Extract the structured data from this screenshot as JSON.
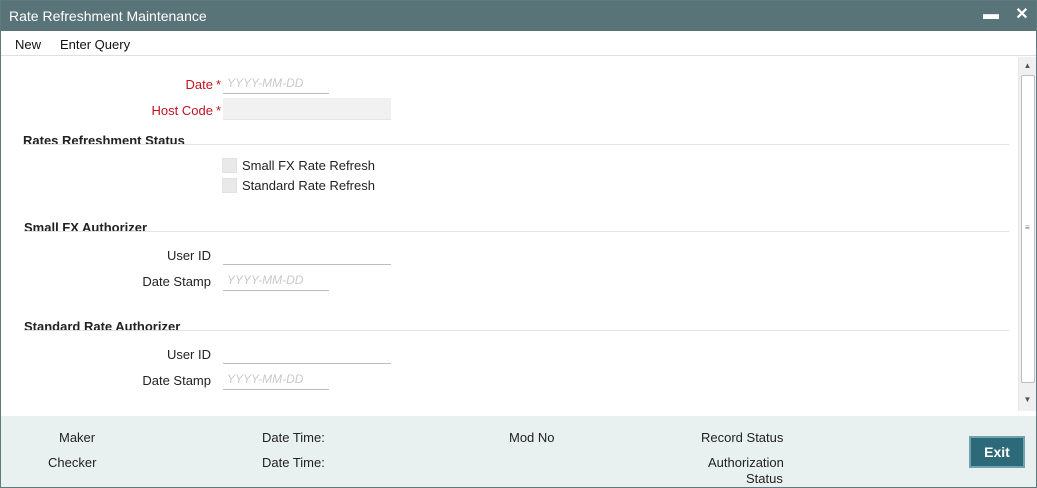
{
  "window": {
    "title": "Rate Refreshment Maintenance",
    "minimize_glyph": "▬",
    "close_glyph": "✕"
  },
  "menu": {
    "new_label": "New",
    "enter_query_label": "Enter Query"
  },
  "form": {
    "date_label": "Date",
    "date_placeholder": "YYYY-MM-DD",
    "host_code_label": "Host Code",
    "required_marker": "*"
  },
  "rates_status": {
    "title": "Rates Refreshment Status",
    "small_fx_label": "Small FX Rate Refresh",
    "standard_label": "Standard Rate Refresh"
  },
  "small_fx_authorizer": {
    "title": "Small FX Authorizer",
    "user_id_label": "User ID",
    "date_stamp_label": "Date Stamp",
    "date_stamp_placeholder": "YYYY-MM-DD"
  },
  "standard_rate_authorizer": {
    "title": "Standard Rate Authorizer",
    "user_id_label": "User ID",
    "date_stamp_label": "Date Stamp",
    "date_stamp_placeholder": "YYYY-MM-DD"
  },
  "footer": {
    "maker_label": "Maker",
    "checker_label": "Checker",
    "date_time_label_1": "Date Time:",
    "date_time_label_2": "Date Time:",
    "mod_no_label": "Mod No",
    "record_status_label": "Record Status",
    "authorization_label_line1": "Authorization",
    "authorization_label_line2": "Status",
    "exit_label": "Exit"
  },
  "colors": {
    "titlebar": "#587478",
    "required": "#c1121f",
    "footer_bg": "#e8f0f0",
    "exit_button": "#2c6a7a"
  }
}
